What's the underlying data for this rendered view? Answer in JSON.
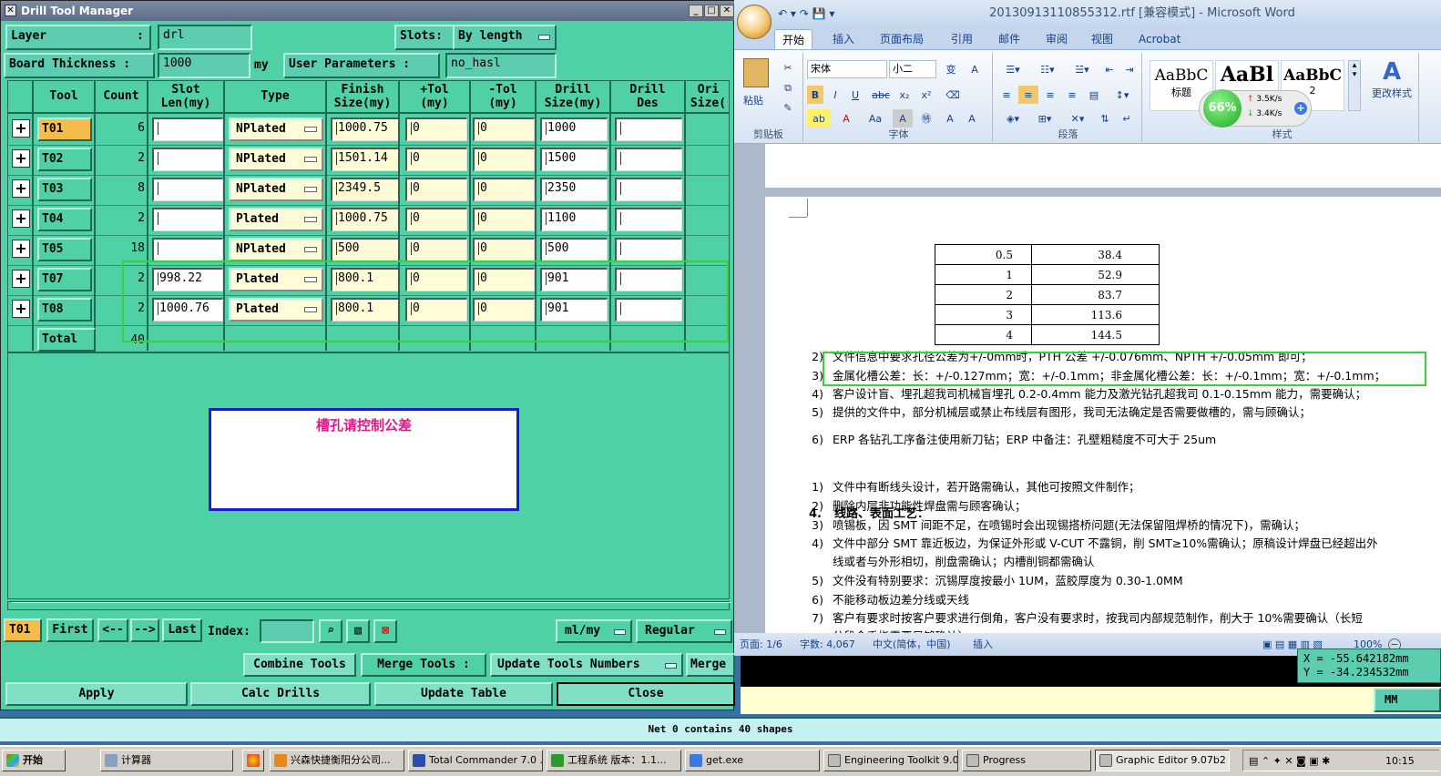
{
  "dtm": {
    "title": "Drill Tool Manager",
    "layer_label": "Layer",
    "layer_colon": ":",
    "layer_value": "drl",
    "slots_label": "Slots:",
    "slots_value": "By length",
    "board_thickness_label": "Board Thickness :",
    "board_thickness_value": "1000",
    "board_thickness_unit": "my",
    "user_params_label": "User Parameters :",
    "user_params_value": "no_hasl",
    "headers": [
      "Tool",
      "Count",
      "Slot\nLen(my)",
      "Type",
      "Finish\nSize(my)",
      "+Tol\n(my)",
      "-Tol\n(my)",
      "Drill\nSize(my)",
      "Drill\nDes",
      "Ori\nSize("
    ],
    "rows": [
      {
        "tool": "T01",
        "count": "6",
        "slot": "",
        "type": "NPlated",
        "finish": "1000.75",
        "ptol": "0",
        "ntol": "0",
        "drill": "1000",
        "des": ""
      },
      {
        "tool": "T02",
        "count": "2",
        "slot": "",
        "type": "NPlated",
        "finish": "1501.14",
        "ptol": "0",
        "ntol": "0",
        "drill": "1500",
        "des": ""
      },
      {
        "tool": "T03",
        "count": "8",
        "slot": "",
        "type": "NPlated",
        "finish": "2349.5",
        "ptol": "0",
        "ntol": "0",
        "drill": "2350",
        "des": ""
      },
      {
        "tool": "T04",
        "count": "2",
        "slot": "",
        "type": "Plated",
        "finish": "1000.75",
        "ptol": "0",
        "ntol": "0",
        "drill": "1100",
        "des": ""
      },
      {
        "tool": "T05",
        "count": "18",
        "slot": "",
        "type": "NPlated",
        "finish": "500",
        "ptol": "0",
        "ntol": "0",
        "drill": "500",
        "des": ""
      },
      {
        "tool": "T07",
        "count": "2",
        "slot": "998.22",
        "type": "Plated",
        "finish": "800.1",
        "ptol": "0",
        "ntol": "0",
        "drill": "901",
        "des": ""
      },
      {
        "tool": "T08",
        "count": "2",
        "slot": "1000.76",
        "type": "Plated",
        "finish": "800.1",
        "ptol": "0",
        "ntol": "0",
        "drill": "901",
        "des": ""
      }
    ],
    "total_label": "Total",
    "total_value": "40",
    "annotation": "槽孔请控制公差",
    "nav": {
      "current": "T01",
      "first": "First",
      "prev": "<--",
      "next": "-->",
      "last": "Last",
      "index_label": "Index:",
      "index_value": "",
      "units": "ml/my",
      "mode": "Regular"
    },
    "buttons": {
      "combine": "Combine Tools",
      "merge_label": "Merge Tools :",
      "update_numbers": "Update Tools Numbers",
      "merge": "Merge",
      "apply": "Apply",
      "calc": "Calc Drills",
      "update_table": "Update Table",
      "close": "Close"
    }
  },
  "word": {
    "title": "20130913110855312.rtf [兼容模式] - Microsoft Word",
    "tabs": [
      "开始",
      "插入",
      "页面布局",
      "引用",
      "邮件",
      "审阅",
      "视图",
      "Acrobat"
    ],
    "font_name": "宋体",
    "font_size": "小二",
    "groups": {
      "clipboard": "剪贴板",
      "font": "字体",
      "paragraph": "段落",
      "styles": "样式"
    },
    "paste": "粘贴",
    "styles": [
      {
        "sample": "AaBbC",
        "name": "标题"
      },
      {
        "sample": "AaBl",
        "name": ""
      },
      {
        "sample": "AaBbC",
        "name": "2"
      }
    ],
    "change_styles": "更改样式",
    "net_widget": {
      "percent": "66%",
      "up": "3.5K/s",
      "down": "3.4K/s"
    },
    "table": [
      [
        "0.5",
        "38.4"
      ],
      [
        "1",
        "52.9"
      ],
      [
        "2",
        "83.7"
      ],
      [
        "3",
        "113.6"
      ],
      [
        "4",
        "144.5"
      ]
    ],
    "lines": [
      {
        "n": "2)",
        "t": "文件信息中要求孔径公差为+/-0mm时，PTH 公差 +/-0.076mm、NPTH +/-0.05mm 即可；"
      },
      {
        "n": "3)",
        "t": "金属化槽公差：长：+/-0.127mm；宽：+/-0.1mm；非金属化槽公差：长：+/-0.1mm；宽：+/-0.1mm；"
      },
      {
        "n": "4)",
        "t": "客户设计盲、埋孔超我司机械盲埋孔 0.2-0.4mm 能力及激光钻孔超我司 0.1-0.15mm 能力，需要确认；"
      },
      {
        "n": "5)",
        "t": "提供的文件中，部分机械层或禁止布线层有图形，我司无法确定是否需要做槽的，需与顾确认；"
      },
      {
        "n": "6)",
        "t": "ERP 各钻孔工序备注使用新刀钻；ERP 中备注：孔壁粗糙度不可大于 25um"
      }
    ],
    "section_num": "4.",
    "section_title": "线路、表面工艺：",
    "lines2": [
      {
        "n": "1)",
        "t": "文件中有断线头设计，若开路需确认，其他可按照文件制作；"
      },
      {
        "n": "2)",
        "t": "删除内层非功能性焊盘需与顾客确认；"
      },
      {
        "n": "3)",
        "t": "喷锡板，因 SMT 间距不足，在喷锡时会出现锡搭桥问题(无法保留阻焊桥的情况下)，需确认；"
      },
      {
        "n": "4)",
        "t": "文件中部分 SMT 靠近板边，为保证外形或 V-CUT 不露铜，削 SMT≥10%需确认；原稿设计焊盘已经超出外"
      },
      {
        "n": "",
        "t": "线或者与外形相切，削盘需确认；内槽削铜都需确认"
      },
      {
        "n": "5)",
        "t": "文件没有特别要求：沉锡厚度按最小 1UM，蓝胶厚度为 0.30-1.0MM"
      },
      {
        "n": "6)",
        "t": "不能移动板边差分线或天线"
      },
      {
        "n": "7)",
        "t": "客户有要求时按客户要求进行倒角，客户没有要求时，按我司内部规范制作，削大于 10%需要确认（长短"
      },
      {
        "n": "",
        "t": "分段金手指需要足够确认）"
      }
    ],
    "status": {
      "page": "页面: 1/6",
      "words": "字数: 4,067",
      "lang": "中文(简体，中国)",
      "mode": "插入",
      "zoom": "100%"
    }
  },
  "coords": {
    "x": "X = -55.642182mm",
    "y": "Y = -34.234532mm"
  },
  "mm_label": "MM",
  "net_status": "Net 0 contains 40 shapes",
  "taskbar": {
    "start": "开始",
    "items": [
      "计算器",
      "兴森快捷衡阳分公司...",
      "Total Commander 7.0 ...",
      "工程系统  版本：1.1...",
      "get.exe",
      "Engineering Toolkit 9.0...",
      "Progress",
      "Graphic Editor 9.07b2 (..."
    ],
    "clock": "10:15"
  },
  "colors": {
    "panel": "#4fd0a5",
    "selected": "#f5bc49",
    "highlight_box": "#3ad13a",
    "annotation_text": "#e0188a",
    "annotation_border": "#1a1acc"
  }
}
